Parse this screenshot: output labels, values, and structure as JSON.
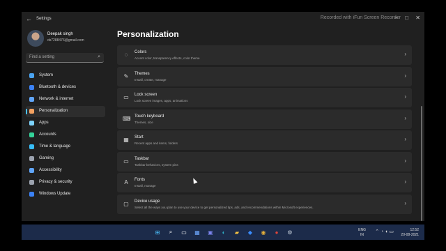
{
  "window": {
    "title": "Settings",
    "watermark": "Recorded with iFun Screen Recorder",
    "controls": [
      "–",
      "□",
      "✕"
    ]
  },
  "profile": {
    "name": "Deepak singh",
    "email": "ds7288476@gmail.com"
  },
  "search": {
    "placeholder": "Find a setting"
  },
  "nav": {
    "items": [
      {
        "label": "System",
        "icon": "monitor-icon",
        "color": "#4aa3f0"
      },
      {
        "label": "Bluetooth & devices",
        "icon": "bluetooth-icon",
        "color": "#3b82f6"
      },
      {
        "label": "Network & internet",
        "icon": "wifi-icon",
        "color": "#60a5fa"
      },
      {
        "label": "Personalization",
        "icon": "brush-icon",
        "color": "#f4a261"
      },
      {
        "label": "Apps",
        "icon": "apps-icon",
        "color": "#7dd3fc"
      },
      {
        "label": "Accounts",
        "icon": "person-icon",
        "color": "#34d399"
      },
      {
        "label": "Time & language",
        "icon": "globe-icon",
        "color": "#38bdf8"
      },
      {
        "label": "Gaming",
        "icon": "gamepad-icon",
        "color": "#9ca3af"
      },
      {
        "label": "Accessibility",
        "icon": "accessibility-icon",
        "color": "#60a5fa"
      },
      {
        "label": "Privacy & security",
        "icon": "shield-icon",
        "color": "#9ca3af"
      },
      {
        "label": "Windows Update",
        "icon": "update-icon",
        "color": "#3b82f6"
      }
    ],
    "active_index": 3
  },
  "page": {
    "title": "Personalization"
  },
  "cards": [
    {
      "title": "Colors",
      "subtitle": "Accent color, transparency effects, color theme",
      "icon": "palette-icon"
    },
    {
      "title": "Themes",
      "subtitle": "Install, create, manage",
      "icon": "brush-icon"
    },
    {
      "title": "Lock screen",
      "subtitle": "Lock screen images, apps, animations",
      "icon": "lock-screen-icon"
    },
    {
      "title": "Touch keyboard",
      "subtitle": "Themes, size",
      "icon": "keyboard-icon"
    },
    {
      "title": "Start",
      "subtitle": "Recent apps and items, folders",
      "icon": "start-icon"
    },
    {
      "title": "Taskbar",
      "subtitle": "Taskbar behaviors, system pins",
      "icon": "taskbar-icon"
    },
    {
      "title": "Fonts",
      "subtitle": "Install, manage",
      "icon": "fonts-icon"
    },
    {
      "title": "Device usage",
      "subtitle": "Select all the ways you plan to use your device to get personalized tips, ads, and recommendations within Microsoft experiences.",
      "icon": "device-usage-icon"
    }
  ],
  "taskbar": {
    "apps": [
      {
        "name": "windows-start-icon",
        "color": "#4cc2ff",
        "glyph": "⊞"
      },
      {
        "name": "search-icon",
        "color": "#ffffff",
        "glyph": "⌕"
      },
      {
        "name": "task-view-icon",
        "color": "#ffffff",
        "glyph": "▭"
      },
      {
        "name": "widgets-icon",
        "color": "#6ea8ff",
        "glyph": "▦"
      },
      {
        "name": "chat-icon",
        "color": "#7b83eb",
        "glyph": "▣"
      },
      {
        "name": "edge-icon",
        "color": "#2fb3c9",
        "glyph": "◐"
      },
      {
        "name": "file-explorer-icon",
        "color": "#f6c343",
        "glyph": "▰"
      },
      {
        "name": "dropbox-icon",
        "color": "#3a8dff",
        "glyph": "◆"
      },
      {
        "name": "chrome-icon",
        "color": "#e8b13a",
        "glyph": "◉"
      },
      {
        "name": "recorder-icon",
        "color": "#e0453a",
        "glyph": "●"
      },
      {
        "name": "settings-icon",
        "color": "#cfd8e3",
        "glyph": "⚙"
      }
    ],
    "lang_top": "ENG",
    "lang_bottom": "IN",
    "tray_icons": "⌃ ◔ ◖ ▭",
    "time": "12:52",
    "date": "20-08-2021"
  }
}
